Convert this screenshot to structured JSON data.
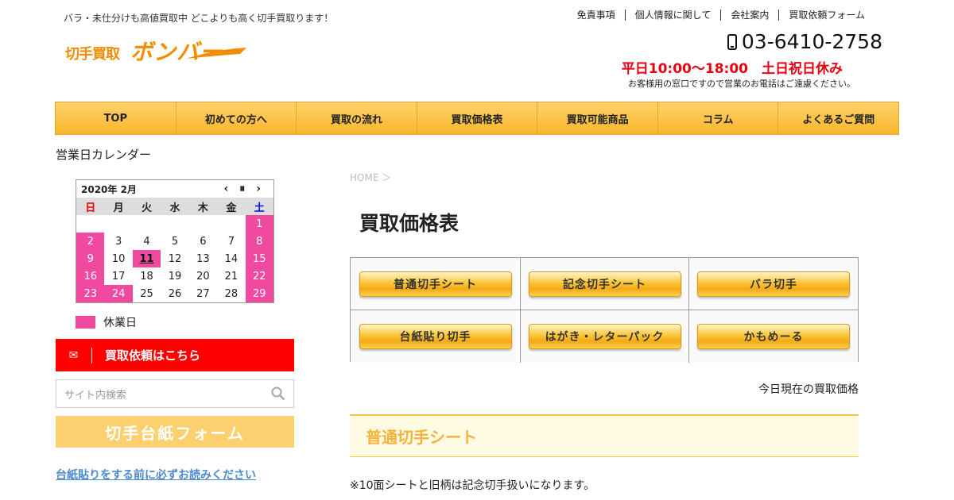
{
  "header": {
    "tagline": "バラ・未仕分けも高値買取中 どこよりも高く切手買取ります！",
    "logo_small": "切手買取",
    "logo_big": "ボンバー",
    "top_links": [
      "免責事項",
      "個人情報に関して",
      "会社案内",
      "買取依頼フォーム"
    ],
    "phone": "03-6410-2758",
    "hours": "平日10:00～18:00　土日祝日休み",
    "hours_note": "お客様用の窓口ですので営業のお電話はご遠慮ください。"
  },
  "nav": [
    "TOP",
    "初めての方へ",
    "買取の流れ",
    "買取価格表",
    "買取可能商品",
    "コラム",
    "よくあるご質問"
  ],
  "sidebar": {
    "calendar_title": "営業日カレンダー",
    "calendar": {
      "month_label": "2020年 2月",
      "prev": "‹",
      "pause": "⏸",
      "next": "›",
      "weekdays": [
        "日",
        "月",
        "火",
        "水",
        "木",
        "金",
        "土"
      ],
      "cells": [
        "",
        "",
        "",
        "",
        "",
        "",
        "1",
        "2",
        "3",
        "4",
        "5",
        "6",
        "7",
        "8",
        "9",
        "10",
        "11",
        "12",
        "13",
        "14",
        "15",
        "16",
        "17",
        "18",
        "19",
        "20",
        "21",
        "22",
        "23",
        "24",
        "25",
        "26",
        "27",
        "28",
        "29"
      ],
      "holidays": [
        "1",
        "2",
        "8",
        "9",
        "15",
        "16",
        "22",
        "23",
        "24",
        "29"
      ],
      "today": "11"
    },
    "legend_label": "休業日",
    "request_button": "買取依頼はこちら",
    "search_placeholder": "サイト内検索",
    "mount_form": "切手台紙フォーム",
    "mount_link": "台紙貼りをする前に必ずお読みください"
  },
  "main": {
    "breadcrumb": "HOME ＞",
    "title": "買取価格表",
    "buttons": [
      "普通切手シート",
      "記念切手シート",
      "バラ切手",
      "台紙貼り切手",
      "はがき・レターパック",
      "かもめーる"
    ],
    "today_label": "今日現在の買取価格",
    "section_title": "普通切手シート",
    "note": "※10面シートと旧柄は記念切手扱いになります。"
  },
  "colors": {
    "brand_orange": "#f28c00",
    "holiday_pink": "#f04aa0",
    "request_red": "#ff0000",
    "hours_red": "#e60012"
  }
}
